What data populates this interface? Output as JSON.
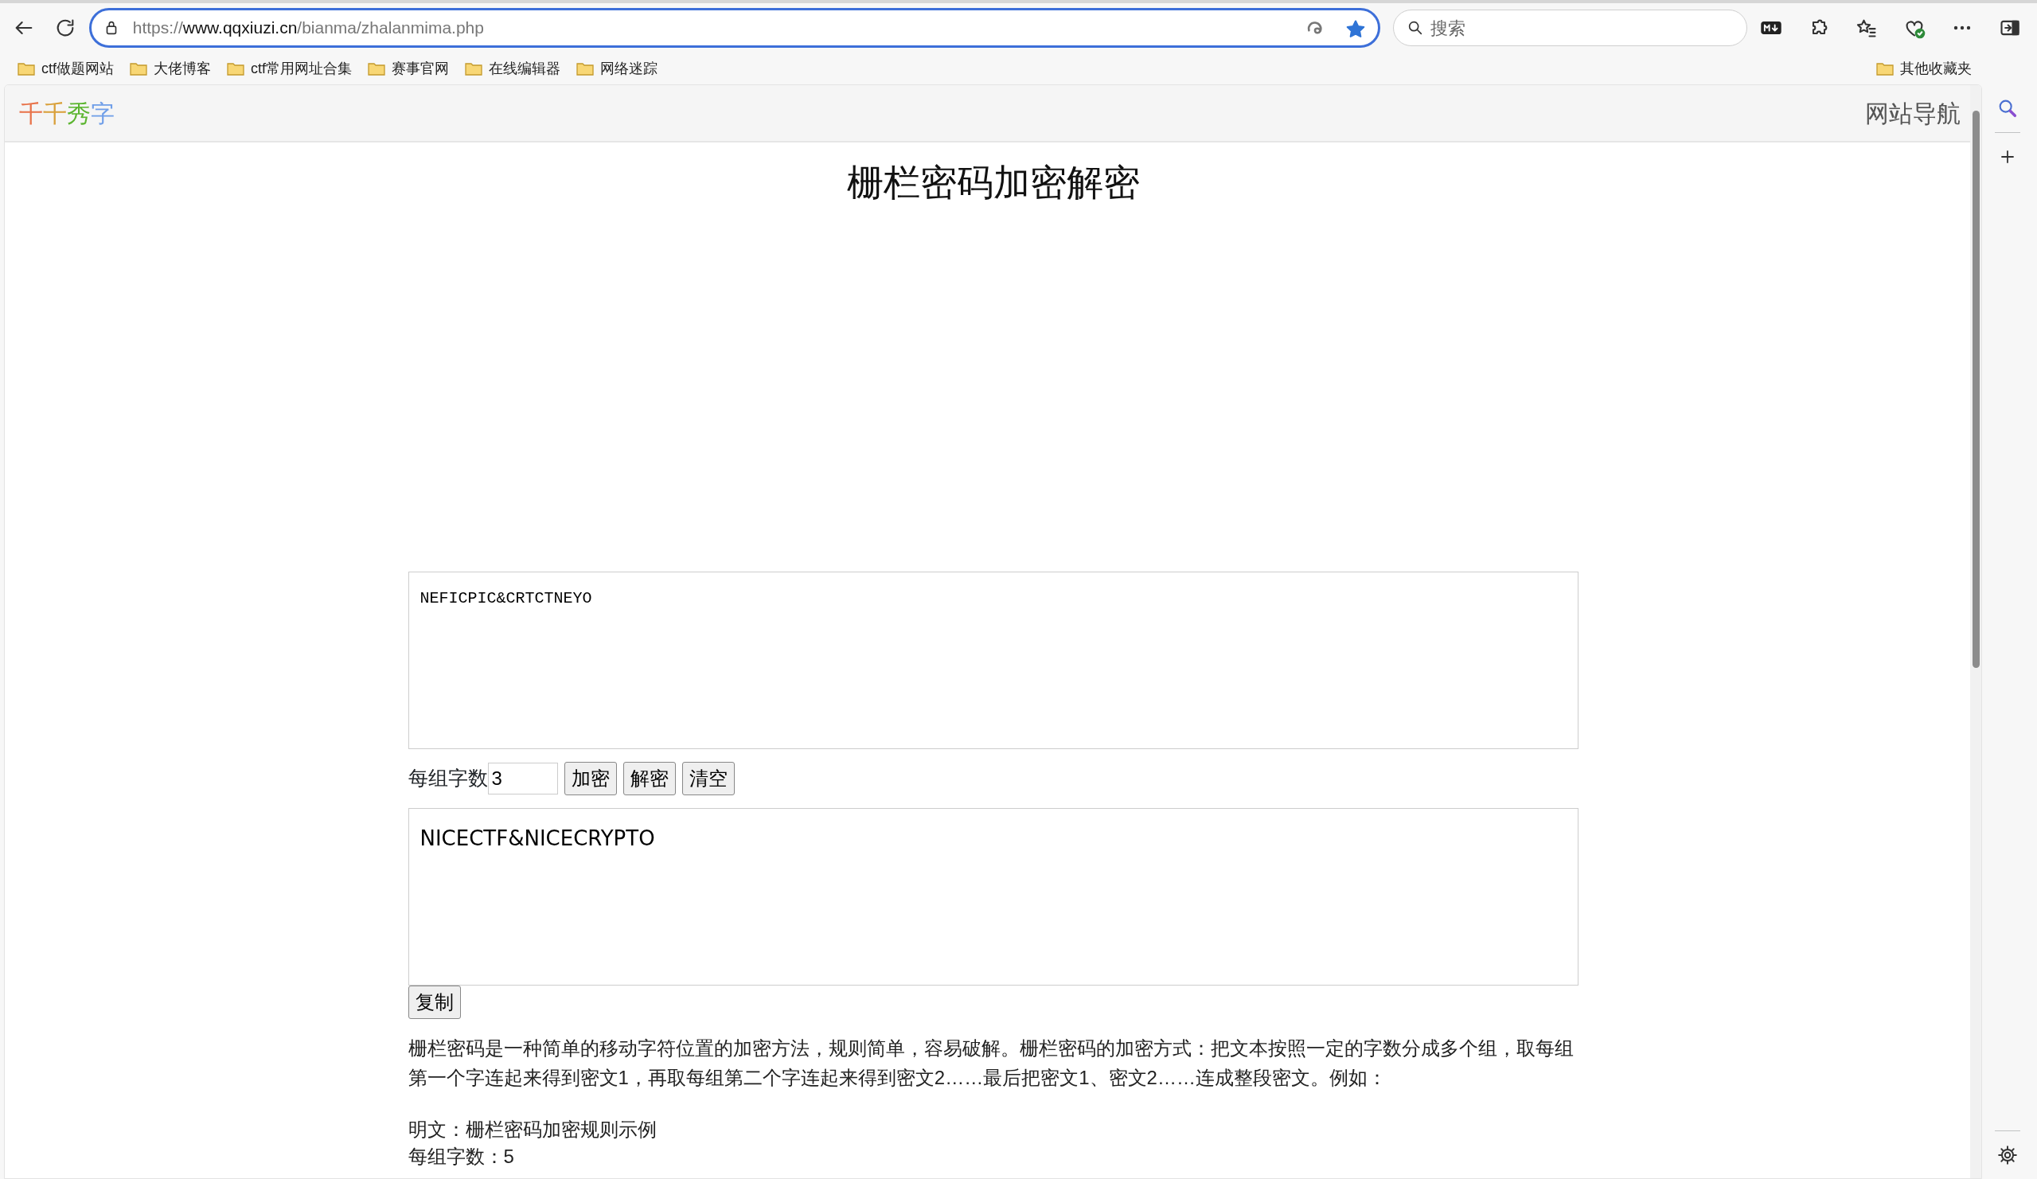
{
  "browser": {
    "url_scheme": "https://",
    "url_host": "www.qqxiuzi.cn",
    "url_path": "/bianma/zhalanmima.php",
    "bookmarked": true,
    "search": {
      "placeholder": "搜索"
    },
    "bookmarks": [
      "ctf做题网站",
      "大佬博客",
      "ctf常用网址合集",
      "赛事官网",
      "在线编辑器",
      "网络迷踪"
    ],
    "other_bookmarks": "其他收藏夹"
  },
  "site": {
    "logo": [
      {
        "text": "千",
        "color": "#e8734a"
      },
      {
        "text": "千",
        "color": "#d9a03a"
      },
      {
        "text": "秀",
        "color": "#5cb531"
      },
      {
        "text": "字",
        "color": "#6f9ee8"
      }
    ],
    "nav_link": "网站导航",
    "title": "栅栏密码加密解密",
    "input_text": "NEFICPIC&CRTCTNEYO",
    "group_size_label": "每组字数",
    "group_size": "3",
    "buttons": [
      "加密",
      "解密",
      "清空"
    ],
    "output_text": "NICECTF&NICECRYPTO",
    "copy_button": "复制",
    "description": "栅栏密码是一种简单的移动字符位置的加密方法，规则简单，容易破解。栅栏密码的加密方式：把文本按照一定的字数分成多个组，取每组第一个字连起来得到密文1，再取每组第二个字连起来得到密文2……最后把密文1、密文2……连成整段密文。例如：",
    "example_lines": [
      "明文：栅栏密码加密规则示例",
      "每组字数：5"
    ]
  }
}
